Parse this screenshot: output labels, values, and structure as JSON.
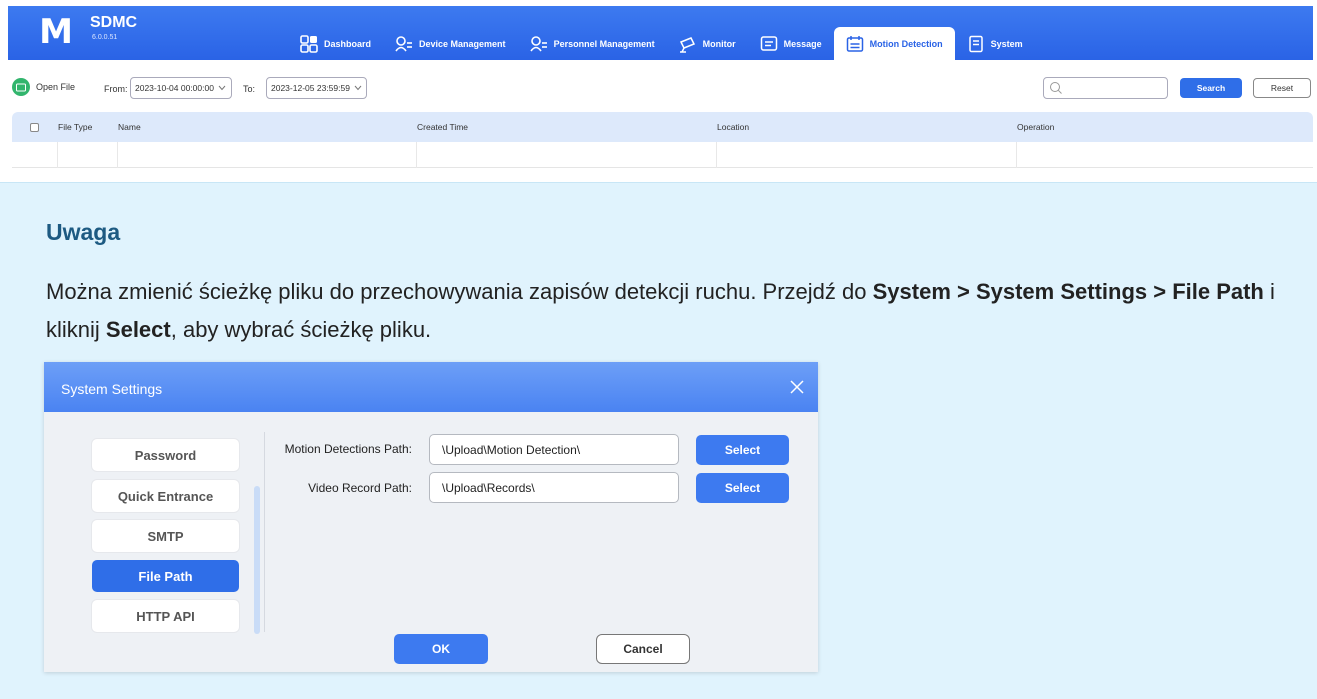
{
  "app": {
    "logo_letter": "M",
    "name": "SDMC",
    "version": "6.0.0.51"
  },
  "nav": {
    "items": [
      {
        "label": "Dashboard",
        "icon": "dashboard-icon"
      },
      {
        "label": "Device Management",
        "icon": "device-management-icon"
      },
      {
        "label": "Personnel Management",
        "icon": "personnel-management-icon"
      },
      {
        "label": "Monitor",
        "icon": "monitor-icon"
      },
      {
        "label": "Message",
        "icon": "message-icon"
      },
      {
        "label": "Motion Detection",
        "icon": "motion-detection-icon",
        "active": true
      },
      {
        "label": "System",
        "icon": "system-icon"
      }
    ]
  },
  "toolbar": {
    "open_file": "Open File",
    "from_label": "From:",
    "from_value": "2023-10-04 00:00:00",
    "to_label": "To:",
    "to_value": "2023-12-05 23:59:59",
    "search_placeholder": "",
    "search_label": "Search",
    "reset_label": "Reset"
  },
  "table": {
    "columns": [
      "File Type",
      "Name",
      "Created Time",
      "Location",
      "Operation"
    ]
  },
  "note": {
    "title": "Uwaga",
    "text_1": "Można zmienić ścieżkę pliku do przechowywania zapisów detekcji ruchu. Przejdź do ",
    "bold_1": "System > System Settings > File Path",
    "text_2": " i kliknij ",
    "bold_2": "Select",
    "text_3": ", aby wybrać ścieżkę pliku."
  },
  "dialog": {
    "title": "System Settings",
    "sidebar": [
      {
        "label": "Password"
      },
      {
        "label": "Quick Entrance"
      },
      {
        "label": "SMTP"
      },
      {
        "label": "File Path",
        "active": true
      },
      {
        "label": "HTTP API"
      }
    ],
    "fields": [
      {
        "label": "Motion Detections Path:",
        "value": "\\Upload\\Motion Detection\\",
        "button": "Select"
      },
      {
        "label": "Video Record Path:",
        "value": "\\Upload\\Records\\",
        "button": "Select"
      }
    ],
    "ok_label": "OK",
    "cancel_label": "Cancel"
  },
  "colors": {
    "accent": "#2f6ee8",
    "note_bg": "#e0f3fd",
    "note_title": "#1d5a82",
    "open_file_icon": "#32b56d"
  }
}
